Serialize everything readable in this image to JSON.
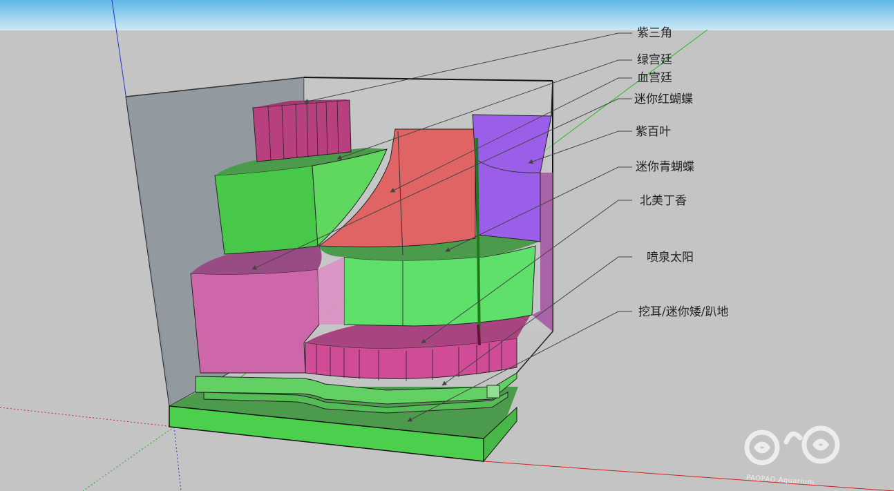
{
  "scene": {
    "sky_top": "#5fb8e6",
    "sky_bottom": "#cde9f4",
    "ground": "#c4c4c4"
  },
  "labels": [
    {
      "text": "紫三角"
    },
    {
      "text": "绿宫廷"
    },
    {
      "text": "血宫廷"
    },
    {
      "text": "迷你红蝴蝶"
    },
    {
      "text": "紫百叶"
    },
    {
      "text": "迷你青蝴蝶"
    },
    {
      "text": "北美丁香"
    },
    {
      "text": "喷泉太阳"
    },
    {
      "text": "挖耳/迷你矮/趴地"
    }
  ],
  "watermark": {
    "text": "PAOPAO Aquarium",
    "logo": "pao-pao-logo-icon"
  },
  "colors": {
    "green": "#4ccf4c",
    "light_green": "#62e062",
    "red": "#e06464",
    "purple": "#9b5ee8",
    "pink": "#d060a8",
    "magenta": "#b8407e",
    "glass": "#8e969c"
  }
}
